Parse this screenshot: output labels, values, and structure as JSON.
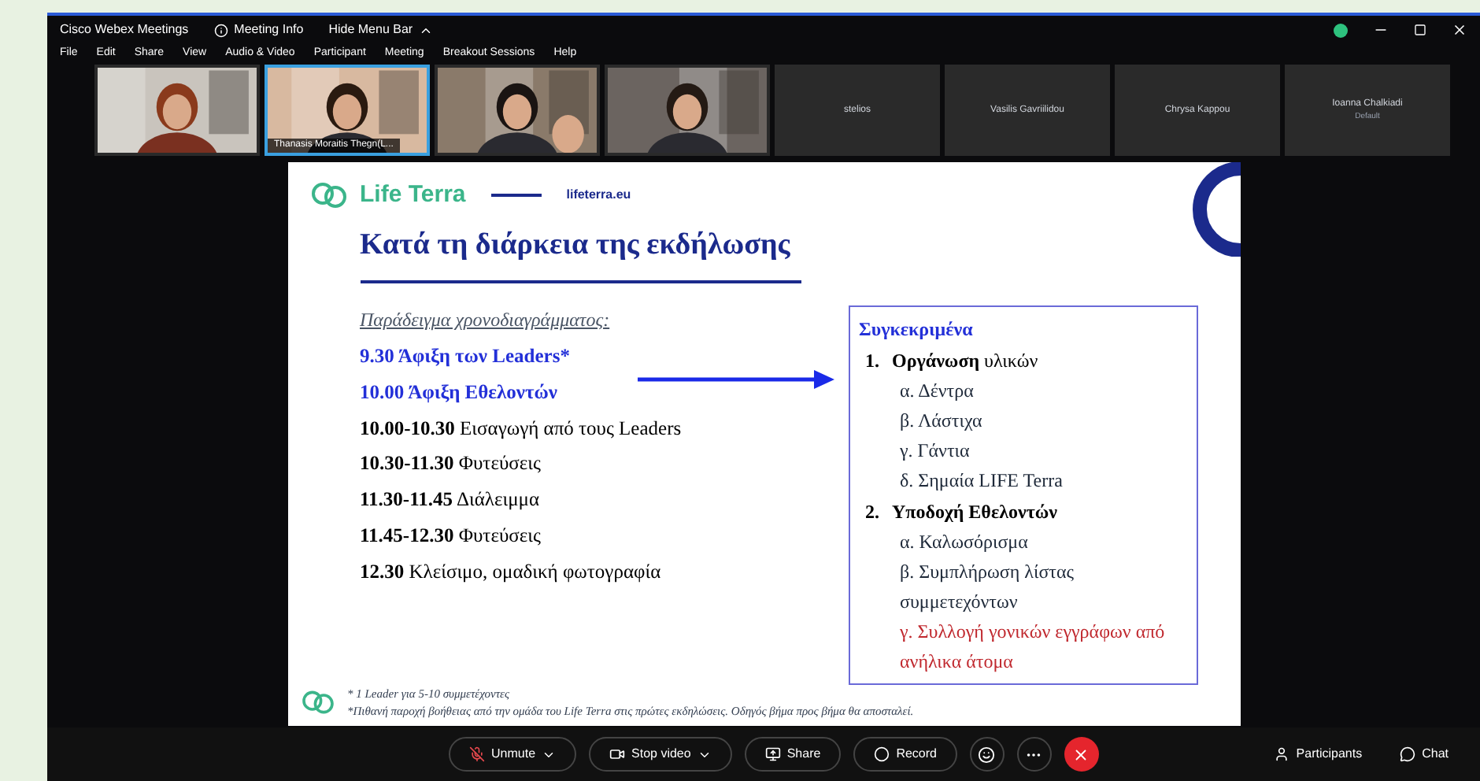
{
  "window": {
    "title": "Cisco Webex Meetings",
    "meeting_info": "Meeting Info",
    "hide_menu_bar": "Hide Menu Bar"
  },
  "menu": [
    "File",
    "Edit",
    "Share",
    "View",
    "Audio & Video",
    "Participant",
    "Meeting",
    "Breakout Sessions",
    "Help"
  ],
  "participants": [
    {
      "kind": "video",
      "speaking": false
    },
    {
      "kind": "video",
      "speaking": true,
      "name": "Thanasis Moraitis Thegn(L..."
    },
    {
      "kind": "video",
      "speaking": false
    },
    {
      "kind": "video",
      "speaking": false
    },
    {
      "kind": "name",
      "speaking": false,
      "name": "stelios"
    },
    {
      "kind": "name",
      "speaking": false,
      "name": "Vasilis Gavriilidou"
    },
    {
      "kind": "name",
      "speaking": false,
      "name": "Chrysa Kappou"
    },
    {
      "kind": "name",
      "speaking": false,
      "name": "Ioanna Chalkiadi",
      "subtitle": "Default"
    }
  ],
  "slide": {
    "brand": "Life Terra",
    "url": "lifeterra.eu",
    "title": "Κατά τη διάρκεια της εκδήλωσης",
    "schedule_heading": "Παράδειγμα χρονοδιαγράμματος:",
    "schedule": [
      {
        "time": "9.30",
        "text": "Άφιξη των Leaders*",
        "highlighted": true
      },
      {
        "time": "10.00",
        "text": "Άφιξη Εθελοντών",
        "highlighted": true
      },
      {
        "time": "10.00-10.30",
        "text": "Εισαγωγή από τους Leaders",
        "highlighted": false
      },
      {
        "time": "10.30-11.30",
        "text": "Φυτεύσεις",
        "highlighted": false
      },
      {
        "time": "11.30-11.45",
        "text": "Διάλειμμα",
        "highlighted": false
      },
      {
        "time": "11.45-12.30",
        "text": "Φυτεύσεις",
        "highlighted": false
      },
      {
        "time": "12.30",
        "text": "Κλείσιμο, ομαδική φωτογραφία",
        "highlighted": false
      }
    ],
    "details": {
      "heading": "Συγκεκριμένα",
      "items": [
        {
          "number": "1.",
          "label": "**Οργάνωση** υλικών",
          "children": [
            {
              "text": "α. Δέντρα",
              "highlighted": false
            },
            {
              "text": "β. Λάστιχα",
              "highlighted": false
            },
            {
              "text": "γ. Γάντια",
              "highlighted": false
            },
            {
              "text": "δ. Σημαία LIFE Terra",
              "highlighted": false
            }
          ]
        },
        {
          "number": "2.",
          "label": "**Υποδοχή Εθελοντών**",
          "children": [
            {
              "text": "α. Καλωσόρισμα",
              "highlighted": false
            },
            {
              "text": "β. Συμπλήρωση λίστας συμμετεχόντων",
              "highlighted": false
            },
            {
              "text": "γ. Συλλογή γονικών εγγράφων από ανήλικα άτομα",
              "highlighted": true
            }
          ]
        }
      ]
    },
    "footnotes": [
      "* 1 Leader για 5-10 συμμετέχοντες",
      "*Πιθανή παροχή βοήθειας από την ομάδα του Life Terra στις πρώτες εκδηλώσεις. Οδηγός βήμα προς βήμα θα αποσταλεί."
    ]
  },
  "toolbar": [
    {
      "kind": "unmute",
      "label": "Unmute",
      "dropdown": true
    },
    {
      "kind": "video",
      "label": "Stop video",
      "dropdown": true
    },
    {
      "kind": "share",
      "label": "Share",
      "dropdown": false
    },
    {
      "kind": "record",
      "label": "Record",
      "dropdown": false
    }
  ],
  "side_buttons": [
    "Participants",
    "Chat"
  ]
}
